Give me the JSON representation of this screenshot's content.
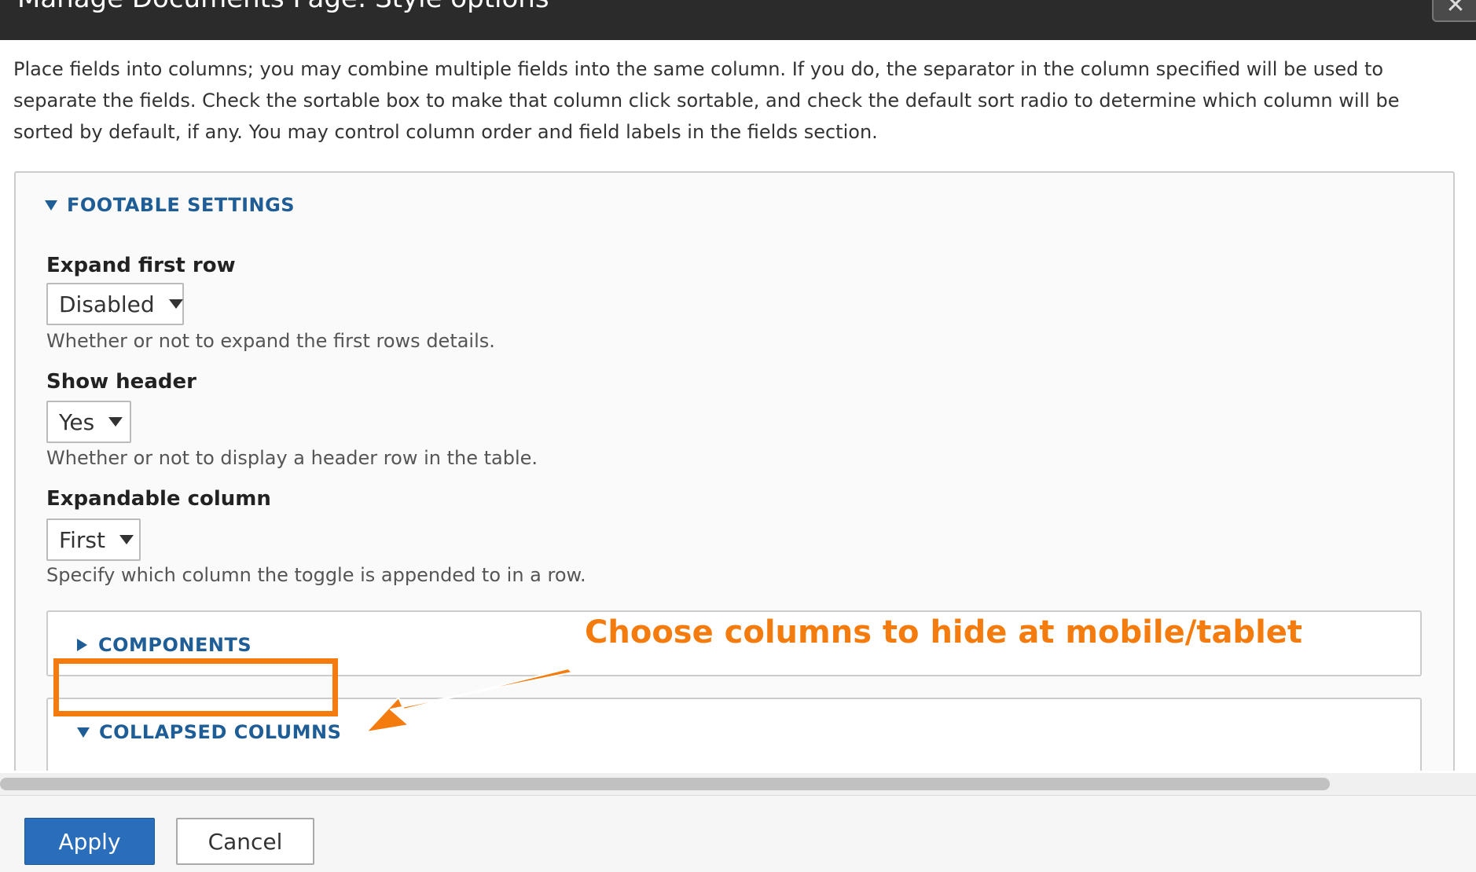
{
  "dialog": {
    "title": "Manage Documents Page: Style options",
    "close_glyph": "✕"
  },
  "intro_text": "Place fields into columns; you may combine multiple fields into the same column. If you do, the separator in the column specified will be used to separate the fields. Check the sortable box to make that column click sortable, and check the default sort radio to determine which column will be sorted by default, if any. You may control column order and field labels in the fields section.",
  "footable": {
    "legend": "FOOTABLE SETTINGS",
    "expand_first_row": {
      "label": "Expand first row",
      "value": "Disabled",
      "description": "Whether or not to expand the first rows details."
    },
    "show_header": {
      "label": "Show header",
      "value": "Yes",
      "description": "Whether or not to display a header row in the table."
    },
    "expandable_column": {
      "label": "Expandable column",
      "value": "First",
      "description": "Specify which column the toggle is appended to in a row."
    },
    "components": {
      "legend": "COMPONENTS"
    },
    "collapsed_columns": {
      "legend": "COLLAPSED COLUMNS"
    }
  },
  "annotation": {
    "text": "Choose columns to hide at mobile/tablet",
    "color": "#f47b0d"
  },
  "buttons": {
    "apply": "Apply",
    "cancel": "Cancel"
  },
  "icons": {
    "close": "close-icon",
    "expanded": "triangle-down-icon",
    "collapsed": "triangle-right-icon",
    "select_caret": "caret-down-icon"
  }
}
